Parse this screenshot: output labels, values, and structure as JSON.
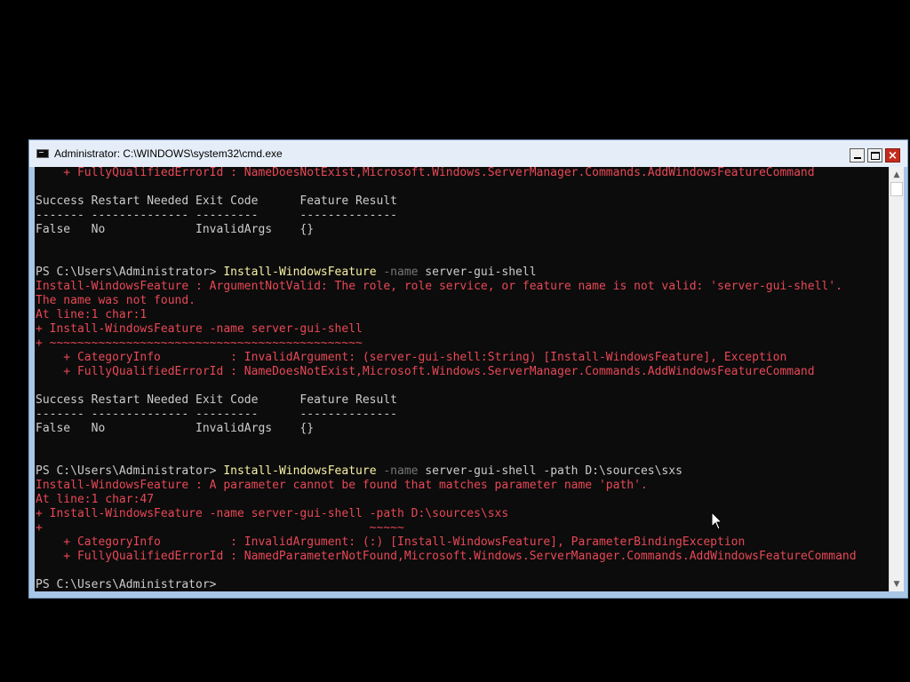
{
  "window": {
    "title": "Administrator: C:\\WINDOWS\\system32\\cmd.exe",
    "icon": "cmd-icon",
    "controls": {
      "minimize": "minimize-icon",
      "maximize": "maximize-icon",
      "close": "×"
    }
  },
  "colors": {
    "console_bg": "#0c0c0c",
    "text": "#cccccc",
    "error": "#e74856",
    "command": "#f9f1a5",
    "parameter": "#767676"
  },
  "console": {
    "lines": [
      {
        "type": "error",
        "text": "    + FullyQualifiedErrorId : NameDoesNotExist,Microsoft.Windows.ServerManager.Commands.AddWindowsFeatureCommand"
      },
      {
        "type": "normal",
        "text": ""
      },
      {
        "type": "normal",
        "text": "Success Restart Needed Exit Code      Feature Result"
      },
      {
        "type": "normal",
        "text": "------- -------------- ---------      --------------"
      },
      {
        "type": "normal",
        "text": "False   No             InvalidArgs    {}"
      },
      {
        "type": "normal",
        "text": ""
      },
      {
        "type": "normal",
        "text": ""
      },
      {
        "type": "command",
        "prompt": "PS C:\\Users\\Administrator> ",
        "cmd": "Install-WindowsFeature",
        "param": " -name",
        "rest": " server-gui-shell"
      },
      {
        "type": "error",
        "text": "Install-WindowsFeature : ArgumentNotValid: The role, role service, or feature name is not valid: 'server-gui-shell'."
      },
      {
        "type": "error",
        "text": "The name was not found."
      },
      {
        "type": "error",
        "text": "At line:1 char:1"
      },
      {
        "type": "error",
        "text": "+ Install-WindowsFeature -name server-gui-shell"
      },
      {
        "type": "error",
        "text": "+ ~~~~~~~~~~~~~~~~~~~~~~~~~~~~~~~~~~~~~~~~~~~~~"
      },
      {
        "type": "error",
        "text": "    + CategoryInfo          : InvalidArgument: (server-gui-shell:String) [Install-WindowsFeature], Exception"
      },
      {
        "type": "error",
        "text": "    + FullyQualifiedErrorId : NameDoesNotExist,Microsoft.Windows.ServerManager.Commands.AddWindowsFeatureCommand"
      },
      {
        "type": "normal",
        "text": ""
      },
      {
        "type": "normal",
        "text": "Success Restart Needed Exit Code      Feature Result"
      },
      {
        "type": "normal",
        "text": "------- -------------- ---------      --------------"
      },
      {
        "type": "normal",
        "text": "False   No             InvalidArgs    {}"
      },
      {
        "type": "normal",
        "text": ""
      },
      {
        "type": "normal",
        "text": ""
      },
      {
        "type": "command",
        "prompt": "PS C:\\Users\\Administrator> ",
        "cmd": "Install-WindowsFeature",
        "param": " -name",
        "rest": " server-gui-shell -path D:\\sources\\sxs"
      },
      {
        "type": "error",
        "text": "Install-WindowsFeature : A parameter cannot be found that matches parameter name 'path'."
      },
      {
        "type": "error",
        "text": "At line:1 char:47"
      },
      {
        "type": "error",
        "text": "+ Install-WindowsFeature -name server-gui-shell -path D:\\sources\\sxs"
      },
      {
        "type": "error",
        "text": "+                                               ~~~~~"
      },
      {
        "type": "error",
        "text": "    + CategoryInfo          : InvalidArgument: (:) [Install-WindowsFeature], ParameterBindingException"
      },
      {
        "type": "error",
        "text": "    + FullyQualifiedErrorId : NamedParameterNotFound,Microsoft.Windows.ServerManager.Commands.AddWindowsFeatureCommand"
      },
      {
        "type": "normal",
        "text": ""
      },
      {
        "type": "normal",
        "text": "PS C:\\Users\\Administrator> "
      }
    ]
  },
  "scrollbar": {
    "up": "▲",
    "down": "▼"
  }
}
